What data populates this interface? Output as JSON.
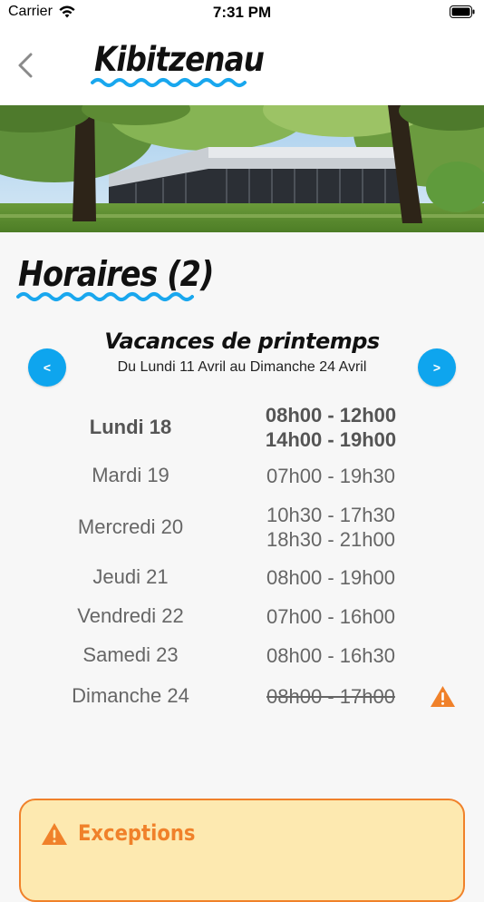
{
  "status_bar": {
    "carrier": "Carrier",
    "time": "7:31 PM"
  },
  "header": {
    "logo_text": "Kibitzenau"
  },
  "section": {
    "title": "Horaires (2)"
  },
  "period": {
    "name": "Vacances de printemps",
    "range": "Du Lundi 11 Avril au Dimanche 24 Avril",
    "prev_label": "<",
    "next_label": ">"
  },
  "schedule": [
    {
      "day": "Lundi 18",
      "hours": [
        "08h00 - 12h00",
        "14h00 - 19h00"
      ],
      "today": true,
      "closed": false,
      "warning": false
    },
    {
      "day": "Mardi 19",
      "hours": [
        "07h00 - 19h30"
      ],
      "today": false,
      "closed": false,
      "warning": false
    },
    {
      "day": "Mercredi 20",
      "hours": [
        "10h30 - 17h30",
        "18h30 - 21h00"
      ],
      "today": false,
      "closed": false,
      "warning": false
    },
    {
      "day": "Jeudi 21",
      "hours": [
        "08h00 - 19h00"
      ],
      "today": false,
      "closed": false,
      "warning": false
    },
    {
      "day": "Vendredi 22",
      "hours": [
        "07h00 - 16h00"
      ],
      "today": false,
      "closed": false,
      "warning": false
    },
    {
      "day": "Samedi 23",
      "hours": [
        "08h00 - 16h30"
      ],
      "today": false,
      "closed": false,
      "warning": false
    },
    {
      "day": "Dimanche 24",
      "hours": [
        "08h00 - 17h00"
      ],
      "today": false,
      "closed": true,
      "warning": true
    }
  ],
  "exceptions": {
    "title": "Exceptions"
  },
  "colors": {
    "accent": "#0ea5ee",
    "warning": "#f0812a",
    "exceptions_bg": "#fde9b0"
  },
  "icons": {
    "back": "chevron-left-icon",
    "wifi": "wifi-icon",
    "battery": "battery-icon",
    "warning": "warning-triangle-icon"
  }
}
